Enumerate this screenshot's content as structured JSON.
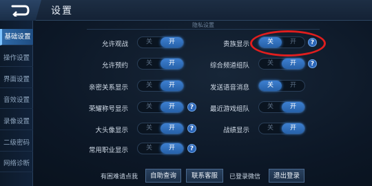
{
  "header": {
    "title": "设置"
  },
  "sidebar": {
    "items": [
      {
        "label": "基础设置",
        "active": true
      },
      {
        "label": "操作设置",
        "active": false
      },
      {
        "label": "界面设置",
        "active": false
      },
      {
        "label": "音效设置",
        "active": false
      },
      {
        "label": "录像设置",
        "active": false
      },
      {
        "label": "二级密码",
        "active": false
      },
      {
        "label": "网络诊断",
        "active": false
      }
    ]
  },
  "section": {
    "title": "隐私设置"
  },
  "toggles": {
    "off_label": "关",
    "on_label": "开",
    "help_label": "?",
    "allow_spectate": {
      "label": "允许观战",
      "value": "开"
    },
    "allow_reserve": {
      "label": "允许预约",
      "value": "开"
    },
    "intimate_display": {
      "label": "亲密关系显示",
      "value": "开"
    },
    "glory_title_display": {
      "label": "荣耀称号显示",
      "value": "开"
    },
    "big_avatar_display": {
      "label": "大头像显示",
      "value": "开"
    },
    "common_role_display": {
      "label": "常用职业显示",
      "value": "开"
    },
    "noble_display": {
      "label": "贵族显示",
      "value": "关"
    },
    "channel_team": {
      "label": "综合频道组队",
      "value": "开"
    },
    "voice_message": {
      "label": "发送语音消息",
      "value": "关"
    },
    "recent_team": {
      "label": "最近游戏组队",
      "value": "开"
    },
    "battle_display": {
      "label": "战绩显示",
      "value": "开"
    }
  },
  "bottom": {
    "help_text": "有困难请点我",
    "self_help_button": "自助查询",
    "contact_button": "联系客服",
    "wechat_text": "已登录微信",
    "logout_button": "退出登录"
  },
  "colors": {
    "accent": "#2f6fc0",
    "annotation": "#e01e1e"
  }
}
